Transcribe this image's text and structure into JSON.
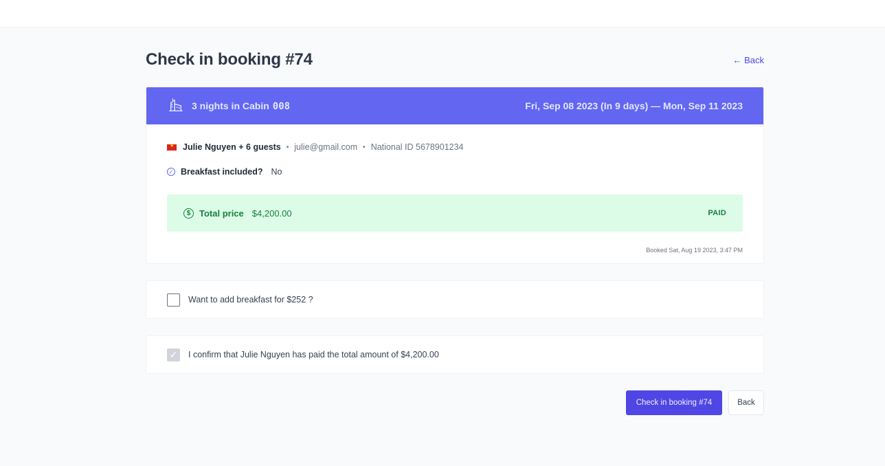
{
  "header": {
    "title": "Check in booking #74",
    "back_link": "← Back"
  },
  "booking": {
    "nights_label": "3 nights in Cabin",
    "cabin_code": "008",
    "dates": "Fri, Sep 08 2023 (In 9 days) — Mon, Sep 11 2023",
    "guest_name": "Julie Nguyen + 6 guests",
    "email": "julie@gmail.com",
    "national_id": "National ID 5678901234",
    "separator": "•",
    "breakfast_label": "Breakfast included?",
    "breakfast_value": "No",
    "total_label": "Total price",
    "total_value": "$4,200.00",
    "payment_status": "PAID",
    "booked_at": "Booked Sat, Aug 19 2023, 3:47 PM",
    "flag_icon": "vietnam-flag-icon"
  },
  "options": {
    "add_breakfast_label": "Want to add breakfast for $252 ?",
    "add_breakfast_checked": false,
    "confirm_paid_label": "I confirm that Julie Nguyen has paid the total amount of $4,200.00",
    "confirm_paid_checked": true
  },
  "actions": {
    "check_in_label": "Check in booking #74",
    "back_label": "Back"
  },
  "colors": {
    "accent": "#4f46e5",
    "header_bg": "#6366f1",
    "paid_bg": "#dcfce7",
    "paid_text": "#15803d"
  }
}
